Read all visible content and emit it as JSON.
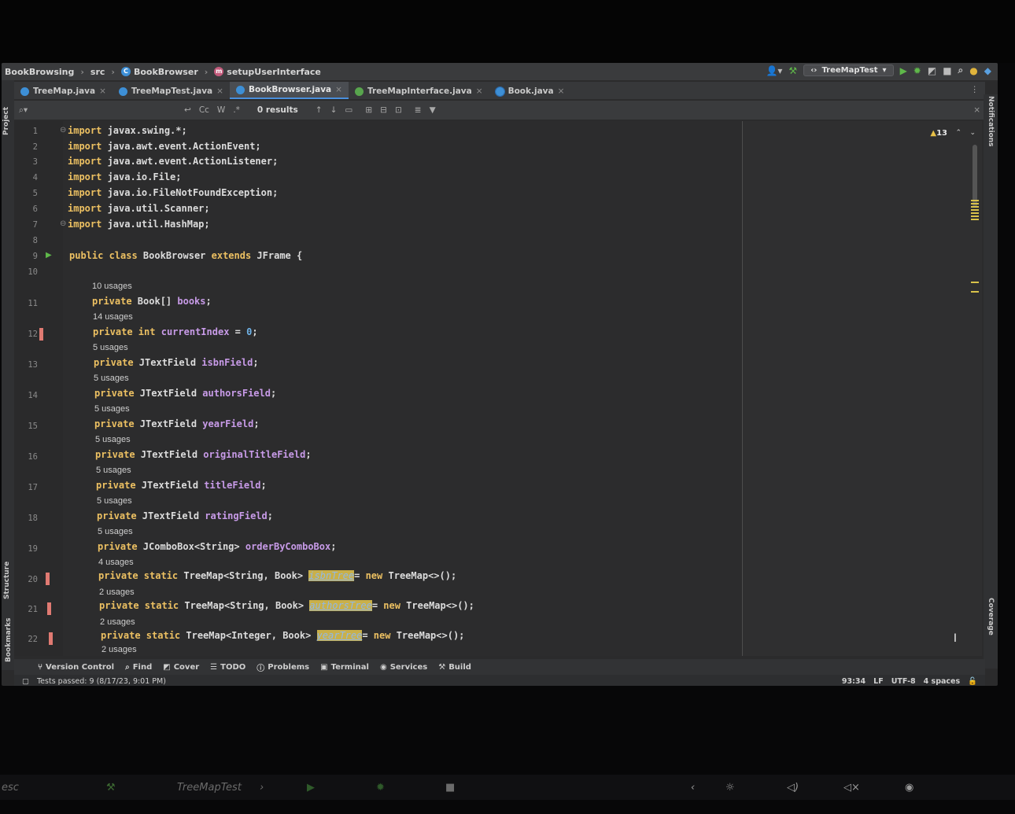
{
  "navbar": {
    "project": "BookBrowsing",
    "folder": "src",
    "class_name": "BookBrowser",
    "method": "setupUserInterface",
    "run_config": "TreeMapTest"
  },
  "tabs": [
    {
      "label": "TreeMap.java",
      "icon": "class-icon",
      "active": false
    },
    {
      "label": "TreeMapTest.java",
      "icon": "class-icon",
      "active": false
    },
    {
      "label": "BookBrowser.java",
      "icon": "class-icon",
      "active": true
    },
    {
      "label": "TreeMapInterface.java",
      "icon": "interface-icon",
      "active": false
    },
    {
      "label": "Book.java",
      "icon": "record-icon",
      "active": false
    }
  ],
  "search": {
    "query": "",
    "case_label": "Cc",
    "word_label": "W",
    "regex_label": ".*",
    "results": "0 results"
  },
  "editor": {
    "warnings_count": "13",
    "lines": [
      {
        "n": "1",
        "t": "import javax.swing.*;"
      },
      {
        "n": "2",
        "t": "import java.awt.event.ActionEvent;"
      },
      {
        "n": "3",
        "t": "import java.awt.event.ActionListener;"
      },
      {
        "n": "4",
        "t": "import java.io.File;"
      },
      {
        "n": "5",
        "t": "import java.io.FileNotFoundException;"
      },
      {
        "n": "6",
        "t": "import java.util.Scanner;"
      },
      {
        "n": "7",
        "t": "import java.util.HashMap;"
      },
      {
        "n": "8",
        "t": ""
      },
      {
        "n": "9",
        "t": "public class BookBrowser extends JFrame {"
      },
      {
        "n": "10",
        "t": ""
      },
      {
        "n": "11",
        "u": "10 usages",
        "t": "private Book[] books;"
      },
      {
        "n": "12",
        "u": "14 usages",
        "t": "private int currentIndex = 0;"
      },
      {
        "n": "13",
        "u": "5 usages",
        "t": "private JTextField isbnField;"
      },
      {
        "n": "14",
        "u": "5 usages",
        "t": "private JTextField authorsField;"
      },
      {
        "n": "15",
        "u": "5 usages",
        "t": "private JTextField yearField;"
      },
      {
        "n": "16",
        "u": "5 usages",
        "t": "private JTextField originalTitleField;"
      },
      {
        "n": "17",
        "u": "5 usages",
        "t": "private JTextField titleField;"
      },
      {
        "n": "18",
        "u": "5 usages",
        "t": "private JTextField ratingField;"
      },
      {
        "n": "19",
        "u": "5 usages",
        "t": "private JComboBox<String> orderByComboBox;"
      },
      {
        "n": "20",
        "u": "4 usages",
        "t": "private static TreeMap<String, Book> isbnTree= new TreeMap<>();"
      },
      {
        "n": "21",
        "u": "2 usages",
        "t": "private static TreeMap<String, Book> authorsTree= new TreeMap<>();"
      },
      {
        "n": "22",
        "u": "2 usages",
        "t": "private static TreeMap<Integer, Book> yearTree= new TreeMap<>();"
      }
    ],
    "trailing_usage": "2 usages"
  },
  "tool_windows": [
    "Version Control",
    "Find",
    "Cover",
    "TODO",
    "Problems",
    "Terminal",
    "Services",
    "Build"
  ],
  "side_panels": {
    "left": [
      "Project",
      "Structure",
      "Bookmarks"
    ],
    "right": [
      "Notifications",
      "Coverage"
    ]
  },
  "status": {
    "message": "Tests passed: 9 (8/17/23, 9:01 PM)",
    "position": "93:34",
    "line_sep": "LF",
    "encoding": "UTF-8",
    "indent": "4 spaces"
  },
  "touchbar": {
    "esc": "esc",
    "config": "TreeMapTest"
  },
  "colors": {
    "keyword": "#ecc062",
    "field": "#c89be8",
    "number": "#6fb3e8",
    "accent": "#4a8fdc"
  }
}
